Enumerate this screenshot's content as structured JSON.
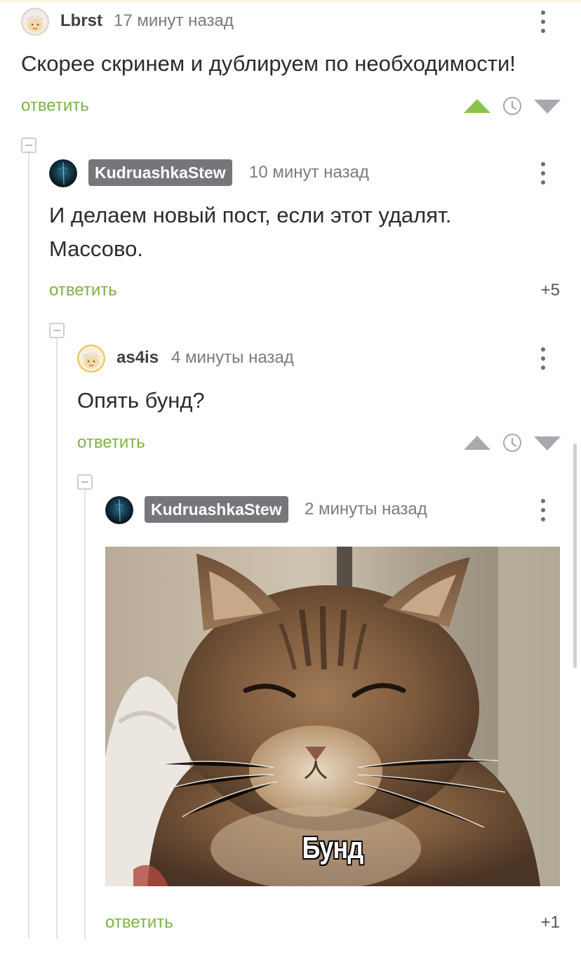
{
  "comments": [
    {
      "username": "Lbrst",
      "time": "17 минут назад",
      "text": "Скорее скринем и дублируем по необходимости!",
      "reply_label": "ответить",
      "upvoted": true
    },
    {
      "username": "KudruashkaStew",
      "time": "10 минут назад",
      "text_lines": [
        "И делаем новый пост, если этот удалят.",
        "Массово."
      ],
      "reply_label": "ответить",
      "score": "+5"
    },
    {
      "username": "as4is",
      "time": "4 минуты назад",
      "text": "Опять бунд?",
      "reply_label": "ответить",
      "upvoted": false
    },
    {
      "username": "KudruashkaStew",
      "time": "2 минуты назад",
      "image_caption": "Бунд",
      "reply_label": "ответить",
      "score": "+1"
    }
  ],
  "colors": {
    "accent_green": "#7cb342",
    "vote_active": "#8ac34a",
    "vote_inactive": "#a8a8ae",
    "badge_bg": "#77777b"
  },
  "icons": {
    "collapse": "minus-square-icon",
    "menu": "more-vertical-icon",
    "upvote": "triangle-up-icon",
    "downvote": "triangle-down-icon",
    "history": "clock-icon"
  }
}
